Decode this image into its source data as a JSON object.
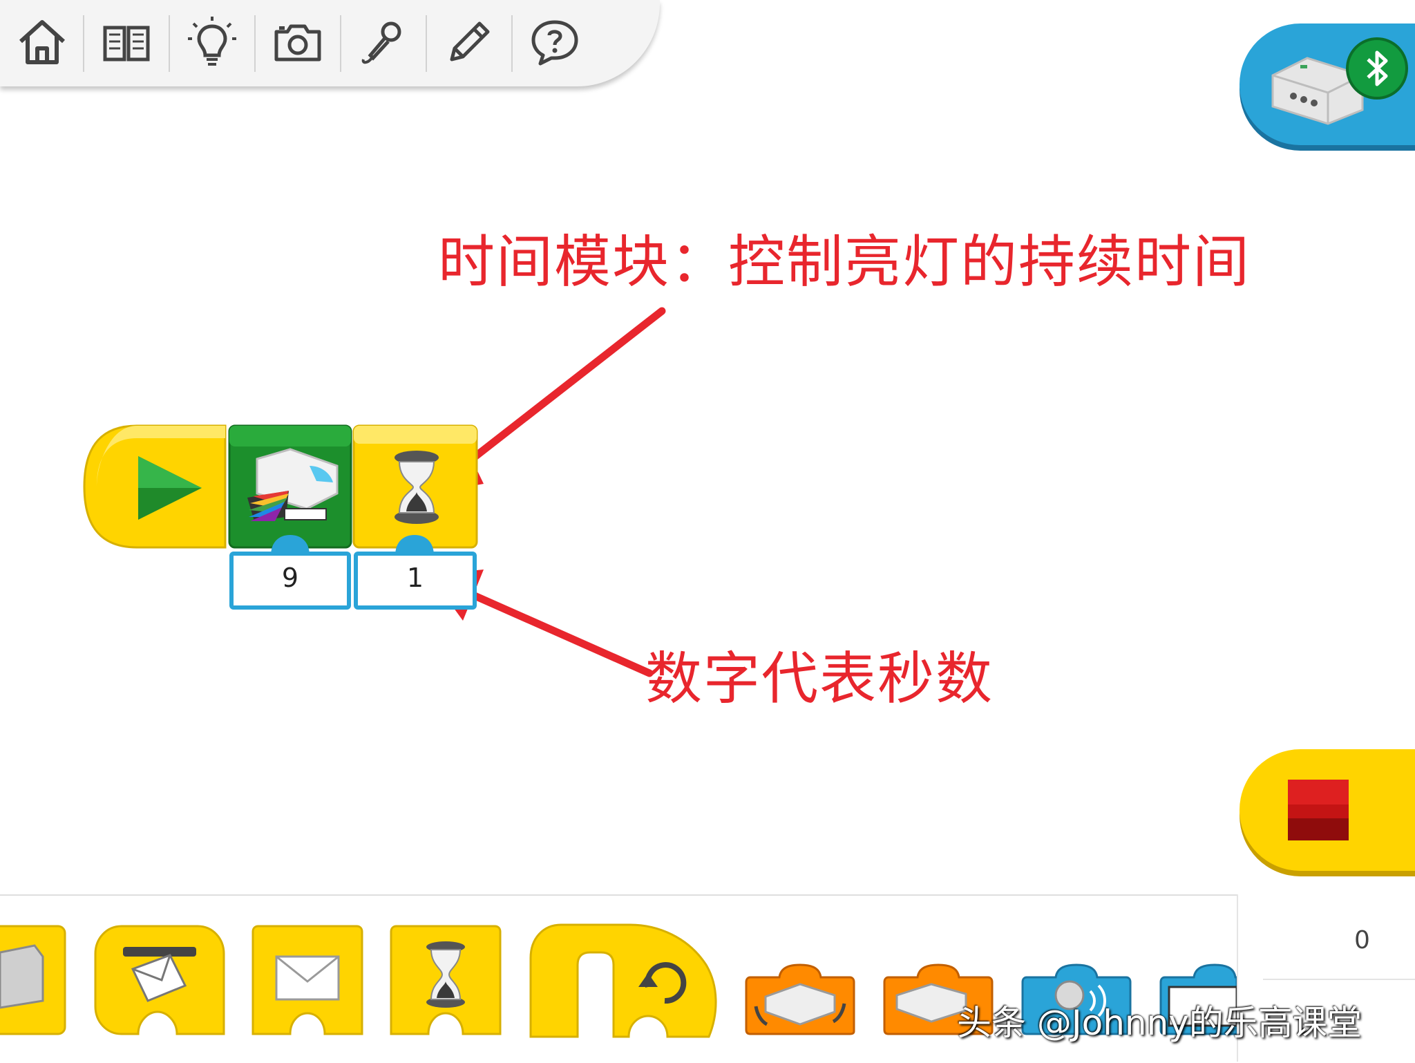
{
  "toolbar": {
    "icons": [
      "home-icon",
      "book-icon",
      "lightbulb-icon",
      "camera-icon",
      "microphone-icon",
      "pencil-icon",
      "help-bubble-icon"
    ]
  },
  "annotations": {
    "timer_note": "时间模块：控制亮灯的持续时间",
    "seconds_note": "数字代表秒数"
  },
  "program": {
    "light_value": "9",
    "wait_value": "1"
  },
  "counter": {
    "value": "0"
  },
  "watermark": "头条 @Johnny的乐高课堂",
  "colors": {
    "block_yellow": "#ffd400",
    "block_green": "#1c8f2c",
    "input_blue": "#2aa4d8",
    "action_orange": "#ff8a00",
    "annotation_red": "#e8262d",
    "stop_red": "#c41414"
  }
}
